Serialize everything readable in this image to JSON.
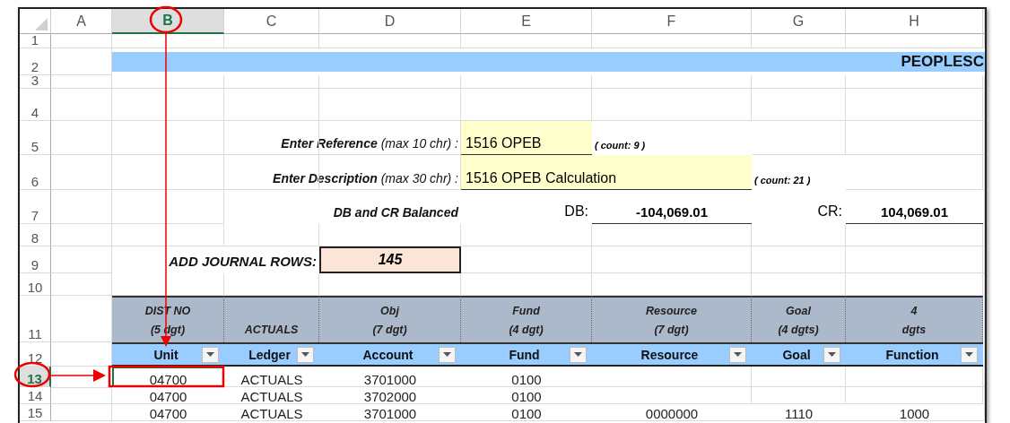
{
  "columns": [
    {
      "label": "A",
      "selected": false
    },
    {
      "label": "B",
      "selected": true
    },
    {
      "label": "C",
      "selected": false
    },
    {
      "label": "D",
      "selected": false
    },
    {
      "label": "E",
      "selected": false
    },
    {
      "label": "F",
      "selected": false
    },
    {
      "label": "G",
      "selected": false
    },
    {
      "label": "H",
      "selected": false
    }
  ],
  "rows": [
    {
      "label": "1",
      "selected": false
    },
    {
      "label": "2",
      "selected": false
    },
    {
      "label": "3",
      "selected": false
    },
    {
      "label": "4",
      "selected": false
    },
    {
      "label": "5",
      "selected": false
    },
    {
      "label": "6",
      "selected": false
    },
    {
      "label": "7",
      "selected": false
    },
    {
      "label": "8",
      "selected": false
    },
    {
      "label": "9",
      "selected": false
    },
    {
      "label": "10",
      "selected": false
    },
    {
      "label": "11",
      "selected": false
    },
    {
      "label": "12",
      "selected": false
    },
    {
      "label": "13",
      "selected": true
    },
    {
      "label": "14",
      "selected": false
    },
    {
      "label": "15",
      "selected": false
    }
  ],
  "banner": {
    "title": "PEOPLESC"
  },
  "reference": {
    "label": "**Enter Reference** (max 10 chr) :",
    "value": "1516 OPEB",
    "count": "( count: 9 )"
  },
  "description": {
    "label": "**Enter Description** (max 30 chr) :",
    "value": "1516 OPEB Calculation",
    "count": "( count: 21 )"
  },
  "balance": {
    "status": "DB and CR Balanced",
    "db_label": "DB:",
    "db_value": "-104,069.01",
    "cr_label": "CR:",
    "cr_value": "104,069.01"
  },
  "add_rows": {
    "label": "ADD JOURNAL ROWS:",
    "value": "145"
  },
  "table": {
    "groups": [
      "DIST NO\n(5 dgt)",
      "ACTUALS",
      "Obj\n(7 dgt)",
      "Fund\n(4 dgt)",
      "Resource\n(7 dgt)",
      "Goal\n(4 dgts)",
      "4\ndgts"
    ],
    "columns": [
      "Unit",
      "Ledger",
      "Account",
      "Fund",
      "Resource",
      "Goal",
      "Function"
    ],
    "rows": [
      [
        "04700",
        "ACTUALS",
        "3701000",
        "0100"
      ],
      [
        "04700",
        "ACTUALS",
        "3702000",
        "0100"
      ],
      [
        "04700",
        "ACTUALS",
        "3701000",
        "0100",
        "0000000",
        "1110",
        "1000"
      ]
    ]
  }
}
